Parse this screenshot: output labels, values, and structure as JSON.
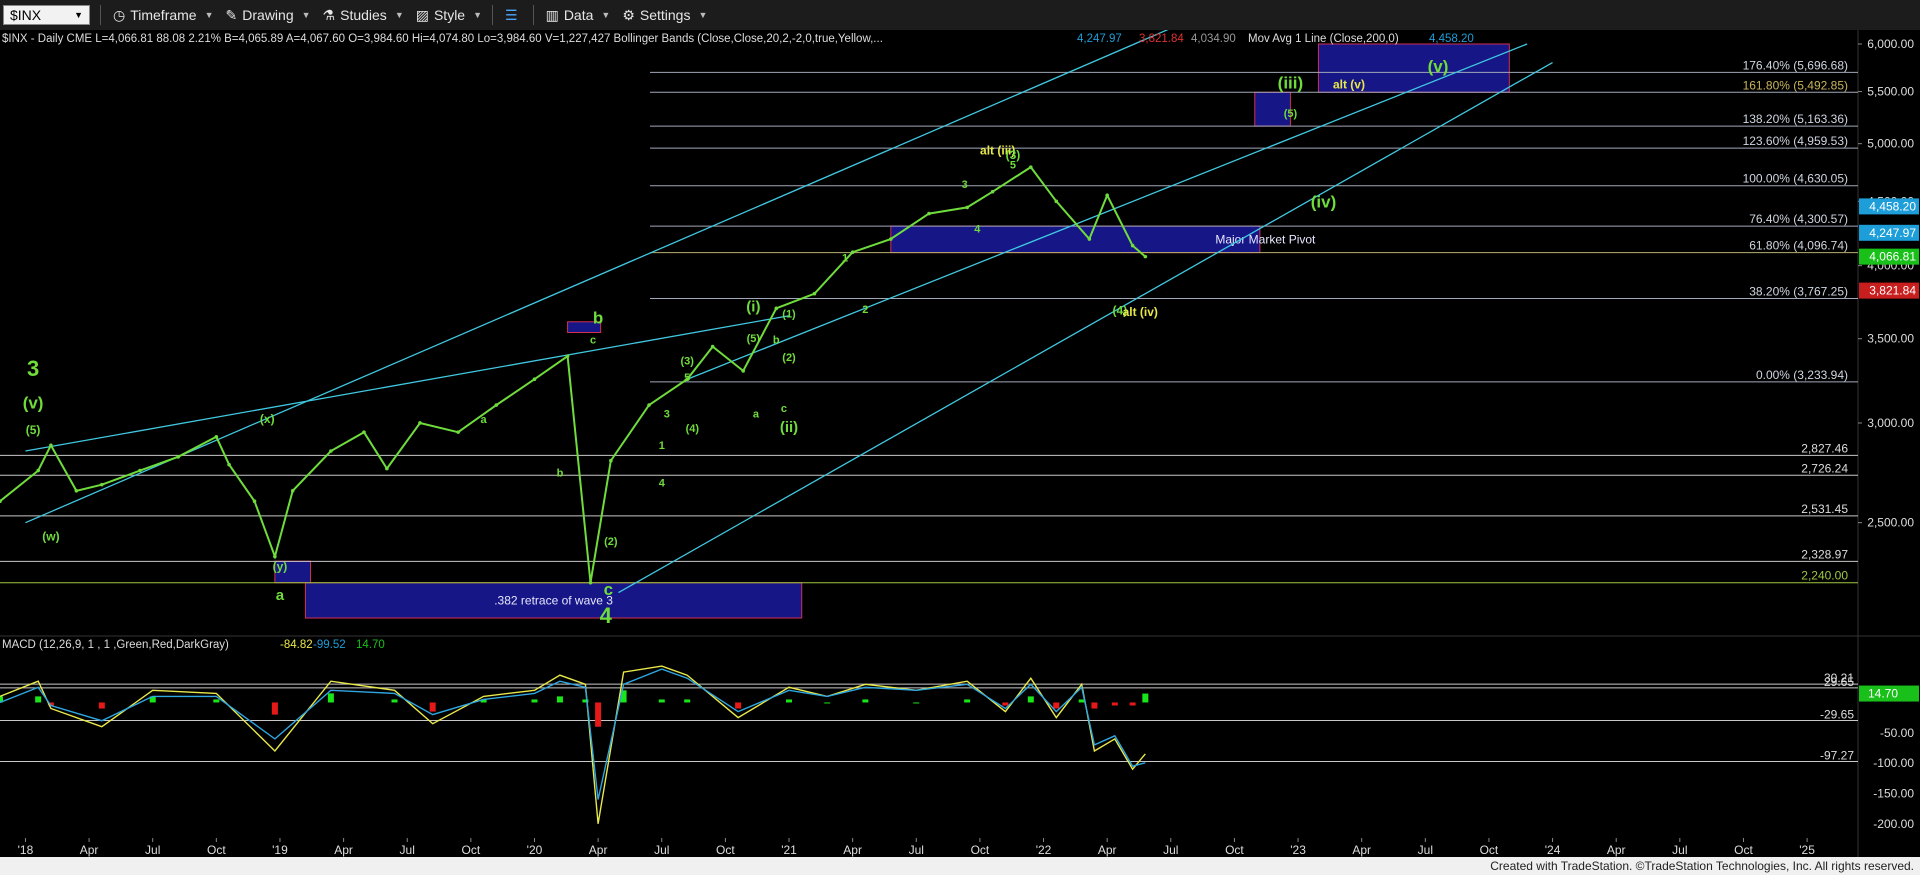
{
  "toolbar": {
    "symbol": "$INX",
    "items": [
      {
        "label": "Timeframe",
        "icon": "clock-icon"
      },
      {
        "label": "Drawing",
        "icon": "pen-icon"
      },
      {
        "label": "Studies",
        "icon": "flask-icon"
      },
      {
        "label": "Style",
        "icon": "style-icon"
      },
      {
        "label": "",
        "icon": "layout-icon"
      },
      {
        "label": "Data",
        "icon": "bar-chart-icon"
      },
      {
        "label": "Settings",
        "icon": "gear-icon"
      }
    ]
  },
  "colors": {
    "background": "#000000",
    "price": "#6fdc3c",
    "wave_green": "#6fdc3c",
    "wave_yellow": "#e8e84a",
    "channel": "#40c8e0",
    "fib_line": "#9fa8b8",
    "box_fill": "#1a1a9e",
    "box_border": "#d03050",
    "macd_hist_pos": "#19e619",
    "macd_hist_neg": "#e61919",
    "axis_text": "#dddddd"
  },
  "header": {
    "info": "$INX - Daily  CME  L=4,066.81  88.08  2.21%  B=4,065.89  A=4,067.60  O=3,984.60  Hi=4,074.80  Lo=3,984.60  V=1,227,427  Bollinger Bands (Close,Close,20,2,-2,0,true,Yellow,...",
    "bb_upper": "4,247.97",
    "bb_lower": "3,821.84",
    "bb_mid": "4,034.90",
    "ma_label": "Mov Avg 1 Line (Close,200,0)",
    "ma_value": "4,458.20"
  },
  "macd_header": {
    "label": "MACD (12,26,9, 1 , 1 ,Green,Red,DarkGray)",
    "v1": "-84.82",
    "v2": "-99.52",
    "v3": "14.70"
  },
  "footer": "Created with TradeStation. ©TradeStation Technologies, Inc. All rights reserved.",
  "chart_data": {
    "type": "line",
    "title": "$INX - Daily",
    "y_scale": "log",
    "ylim": [
      2100,
      6000
    ],
    "x_ticks": [
      "'18",
      "Apr",
      "Jul",
      "Oct",
      "'19",
      "Apr",
      "Jul",
      "Oct",
      "'20",
      "Apr",
      "Jul",
      "Oct",
      "'21",
      "Apr",
      "Jul",
      "Oct",
      "'22",
      "Apr",
      "Jul",
      "Oct",
      "'23",
      "Apr",
      "Jul",
      "Oct",
      "'24",
      "Apr",
      "Jul",
      "Oct",
      "'25"
    ],
    "y_ticks": [
      "6,000.00",
      "5,500.00",
      "5,000.00",
      "4,500.00",
      "4,000.00",
      "3,500.00",
      "3,000.00",
      "2,500.00"
    ],
    "series": [
      {
        "x": [
          2017.9,
          2018.05,
          2018.1,
          2018.2,
          2018.3,
          2018.45,
          2018.6,
          2018.75,
          2018.8,
          2018.9,
          2018.98,
          2019.05,
          2019.2,
          2019.33,
          2019.42,
          2019.55,
          2019.7,
          2019.85,
          2020.0,
          2020.13,
          2020.22,
          2020.3,
          2020.45,
          2020.6,
          2020.7,
          2020.82,
          2020.95,
          2021.1,
          2021.25,
          2021.4,
          2021.55,
          2021.7,
          2021.8,
          2021.95,
          2022.05,
          2022.18,
          2022.25,
          2022.35,
          2022.4
        ],
        "y": [
          2600,
          2750,
          2880,
          2650,
          2680,
          2750,
          2820,
          2925,
          2780,
          2600,
          2350,
          2650,
          2850,
          2950,
          2760,
          3000,
          2950,
          3100,
          3250,
          3390,
          2240,
          2800,
          3100,
          3250,
          3450,
          3300,
          3700,
          3800,
          4100,
          4200,
          4400,
          4450,
          4580,
          4790,
          4500,
          4200,
          4550,
          4150,
          4066.81
        ]
      }
    ],
    "fib_levels": [
      {
        "label": "176.40% (5,696.68)",
        "value": 5696.68
      },
      {
        "label": "161.80% (5,492.85)",
        "value": 5492.85
      },
      {
        "label": "138.20% (5,163.36)",
        "value": 5163.36
      },
      {
        "label": "123.60% (4,959.53)",
        "value": 4959.53
      },
      {
        "label": "100.00% (4,630.05)",
        "value": 4630.05
      },
      {
        "label": "76.40% (4,300.57)",
        "value": 4300.57
      },
      {
        "label": "61.80% (4,096.74)",
        "value": 4096.74
      },
      {
        "label": "38.20% (3,767.25)",
        "value": 3767.25
      },
      {
        "label": "0.00% (3,233.94)",
        "value": 3233.94
      }
    ],
    "horizontal_levels": [
      {
        "label": "2,827.46",
        "value": 2827.46
      },
      {
        "label": "2,726.24",
        "value": 2726.24
      },
      {
        "label": "2,531.45",
        "value": 2531.45
      },
      {
        "label": "2,328.97",
        "value": 2328.97
      },
      {
        "label": "2,240.00",
        "value": 2240
      }
    ],
    "price_tags": [
      {
        "label": "4,458.20",
        "value": 4458.2,
        "color": "#1e9ed8"
      },
      {
        "label": "4,247.97",
        "value": 4247.97,
        "color": "#1e9ed8"
      },
      {
        "label": "4,066.81",
        "value": 4066.81,
        "color": "#19c019"
      },
      {
        "label": "3,821.84",
        "value": 3821.84,
        "color": "#c81e1e"
      }
    ],
    "wave_labels": [
      {
        "text": "3",
        "x": 2018.03,
        "y": 3270,
        "color": "green",
        "size": "xl"
      },
      {
        "text": "(v)",
        "x": 2018.03,
        "y": 3080,
        "color": "green",
        "size": "l"
      },
      {
        "text": "(5)",
        "x": 2018.03,
        "y": 2940,
        "color": "green",
        "size": "s"
      },
      {
        "text": "(w)",
        "x": 2018.1,
        "y": 2420,
        "color": "green",
        "size": "s"
      },
      {
        "text": "(x)",
        "x": 2018.95,
        "y": 3000,
        "color": "green",
        "size": "s"
      },
      {
        "text": "(y)",
        "x": 2019.0,
        "y": 2290,
        "color": "green",
        "size": "s"
      },
      {
        "text": "a",
        "x": 2019.0,
        "y": 2170,
        "color": "green",
        "size": "m"
      },
      {
        "text": "a",
        "x": 2019.8,
        "y": 3000,
        "color": "green",
        "size": "xs"
      },
      {
        "text": "b",
        "x": 2020.1,
        "y": 2720,
        "color": "green",
        "size": "xs"
      },
      {
        "text": "b",
        "x": 2020.25,
        "y": 3600,
        "color": "green",
        "size": "l"
      },
      {
        "text": "c",
        "x": 2020.23,
        "y": 3470,
        "color": "green",
        "size": "xs"
      },
      {
        "text": "c",
        "x": 2020.29,
        "y": 2190,
        "color": "green",
        "size": "l"
      },
      {
        "text": "4",
        "x": 2020.28,
        "y": 2080,
        "color": "green",
        "size": "xl"
      },
      {
        "text": "(2)",
        "x": 2020.3,
        "y": 2400,
        "color": "green",
        "size": "xs"
      },
      {
        "text": "1",
        "x": 2020.5,
        "y": 2860,
        "color": "green",
        "size": "xs"
      },
      {
        "text": "3",
        "x": 2020.52,
        "y": 3030,
        "color": "green",
        "size": "xs"
      },
      {
        "text": "(3)",
        "x": 2020.6,
        "y": 3340,
        "color": "green",
        "size": "xs"
      },
      {
        "text": "5",
        "x": 2020.6,
        "y": 3240,
        "color": "green",
        "size": "xs"
      },
      {
        "text": "(4)",
        "x": 2020.62,
        "y": 2950,
        "color": "green",
        "size": "xs"
      },
      {
        "text": "4",
        "x": 2020.5,
        "y": 2670,
        "color": "green",
        "size": "xs"
      },
      {
        "text": "(i)",
        "x": 2020.86,
        "y": 3680,
        "color": "green",
        "size": "m"
      },
      {
        "text": "(5)",
        "x": 2020.86,
        "y": 3480,
        "color": "green",
        "size": "xs"
      },
      {
        "text": "b",
        "x": 2020.95,
        "y": 3470,
        "color": "green",
        "size": "xs"
      },
      {
        "text": "a",
        "x": 2020.87,
        "y": 3030,
        "color": "green",
        "size": "xs"
      },
      {
        "text": "c",
        "x": 2020.98,
        "y": 3060,
        "color": "green",
        "size": "xs"
      },
      {
        "text": "(ii)",
        "x": 2021.0,
        "y": 2950,
        "color": "green",
        "size": "m"
      },
      {
        "text": "(1)",
        "x": 2021.0,
        "y": 3640,
        "color": "green",
        "size": "xs"
      },
      {
        "text": "(2)",
        "x": 2021.0,
        "y": 3360,
        "color": "green",
        "size": "xs"
      },
      {
        "text": "1",
        "x": 2021.22,
        "y": 4030,
        "color": "green",
        "size": "xs"
      },
      {
        "text": "2",
        "x": 2021.3,
        "y": 3670,
        "color": "green",
        "size": "xs"
      },
      {
        "text": "3",
        "x": 2021.69,
        "y": 4610,
        "color": "green",
        "size": "xs"
      },
      {
        "text": "4",
        "x": 2021.74,
        "y": 4250,
        "color": "green",
        "size": "xs"
      },
      {
        "text": "alt (iii)",
        "x": 2021.82,
        "y": 4900,
        "color": "yellow",
        "size": "s"
      },
      {
        "text": "(3)",
        "x": 2021.88,
        "y": 4860,
        "color": "green",
        "size": "s"
      },
      {
        "text": "5",
        "x": 2021.88,
        "y": 4780,
        "color": "green",
        "size": "xs"
      },
      {
        "text": "(4)",
        "x": 2022.3,
        "y": 3660,
        "color": "green",
        "size": "s"
      },
      {
        "text": "alt (iv)",
        "x": 2022.38,
        "y": 3650,
        "color": "yellow",
        "size": "s"
      },
      {
        "text": "(iii)",
        "x": 2022.97,
        "y": 5530,
        "color": "green",
        "size": "l"
      },
      {
        "text": "(5)",
        "x": 2022.97,
        "y": 5250,
        "color": "green",
        "size": "xs"
      },
      {
        "text": "alt (v)",
        "x": 2023.2,
        "y": 5530,
        "color": "yellow",
        "size": "s"
      },
      {
        "text": "(v)",
        "x": 2023.55,
        "y": 5700,
        "color": "green",
        "size": "l"
      },
      {
        "text": "(iv)",
        "x": 2023.1,
        "y": 4450,
        "color": "green",
        "size": "l"
      }
    ],
    "zones": [
      {
        "label": ".382 retrace of wave 3",
        "x": [
          2019.1,
          2021.05
        ],
        "y": [
          1950,
          2240
        ]
      },
      {
        "label": "Major Market Pivot",
        "x": [
          2021.4,
          2022.85
        ],
        "y": [
          4096.74,
          4300.57
        ]
      },
      {
        "label": "",
        "x": [
          2018.98,
          2019.12
        ],
        "y": [
          2240,
          2330
        ]
      },
      {
        "label": "",
        "x": [
          2020.13,
          2020.26
        ],
        "y": [
          3540,
          3610
        ]
      },
      {
        "label": "",
        "x": [
          2022.83,
          2022.97
        ],
        "y": [
          5163.36,
          5492.85
        ]
      },
      {
        "label": "",
        "x": [
          2023.08,
          2023.83
        ],
        "y": [
          5492.85,
          6000
        ]
      }
    ],
    "macd": {
      "ylim": [
        -230,
        70
      ],
      "y_ticks": [
        "-50.00",
        "-100.00",
        "-150.00",
        "-200.00"
      ],
      "levels": [
        {
          "label": "30.21",
          "value": 30.21
        },
        {
          "label": "29.65",
          "value": 24
        },
        {
          "label": "-29.65",
          "value": -29.65
        },
        {
          "label": "-97.27",
          "value": -97.27
        }
      ],
      "current_tag": {
        "label": "14.70",
        "value": 14.7
      },
      "x": [
        2017.9,
        2018.05,
        2018.1,
        2018.3,
        2018.5,
        2018.75,
        2018.98,
        2019.2,
        2019.45,
        2019.6,
        2019.8,
        2020.0,
        2020.1,
        2020.2,
        2020.25,
        2020.35,
        2020.5,
        2020.6,
        2020.8,
        2021.0,
        2021.15,
        2021.3,
        2021.5,
        2021.7,
        2021.85,
        2021.95,
        2022.05,
        2022.15,
        2022.2,
        2022.28,
        2022.35,
        2022.4
      ],
      "macd": [
        10,
        35,
        -10,
        -40,
        20,
        15,
        -80,
        35,
        20,
        -35,
        10,
        20,
        45,
        30,
        -200,
        50,
        60,
        45,
        -25,
        25,
        10,
        30,
        20,
        35,
        -15,
        40,
        -25,
        30,
        -80,
        -60,
        -110,
        -84.82
      ],
      "signal": [
        0,
        25,
        -5,
        -30,
        10,
        10,
        -60,
        20,
        15,
        -20,
        5,
        15,
        35,
        25,
        -160,
        30,
        55,
        40,
        -15,
        20,
        10,
        25,
        20,
        30,
        -10,
        30,
        -15,
        25,
        -70,
        -55,
        -105,
        -99.52
      ]
    }
  }
}
